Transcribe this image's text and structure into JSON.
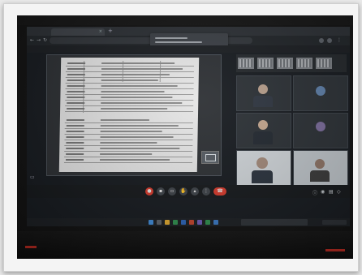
{
  "photo": {
    "subject": "laptop-screen-video-meeting",
    "colors": {
      "frame": "#f4f4f4",
      "screen": "#161a1f",
      "end_call": "#d83a2c",
      "document": "#e6e6e6",
      "desk": "#0b0b0b"
    }
  },
  "screen": {
    "browser": {
      "tab_label": "",
      "meeting_title": ""
    },
    "presenter_label": "",
    "participants": [
      {
        "label": ""
      },
      {
        "label": ""
      },
      {
        "label": ""
      },
      {
        "label": ""
      },
      {
        "label": ""
      },
      {
        "label": ""
      }
    ],
    "icons": [
      "mic-icon",
      "camera-icon",
      "captions-icon",
      "raise-hand-icon",
      "present-icon",
      "more-options-icon",
      "end-call-icon",
      "info-icon",
      "people-icon",
      "chat-icon",
      "activities-icon"
    ]
  }
}
